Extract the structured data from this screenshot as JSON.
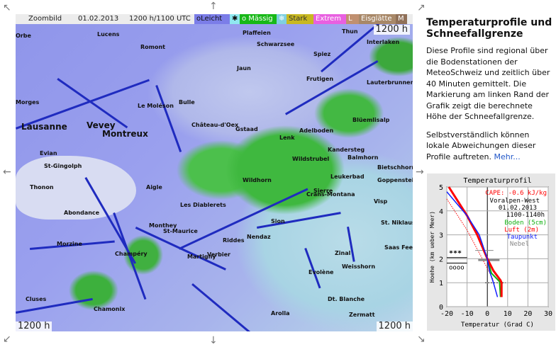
{
  "map": {
    "header": {
      "title": "Zoombild",
      "date": "01.02.2013",
      "time": "1200 h/1100 UTC"
    },
    "legend": [
      {
        "label": "oLeicht",
        "bg": "#7b7de8",
        "fg": "#111"
      },
      {
        "label": "✱",
        "bg": "#90e8f0",
        "fg": "#111"
      },
      {
        "label": "o Mässig",
        "bg": "#18b818",
        "fg": "#fff"
      },
      {
        "label": "❄",
        "bg": "#80d0e0",
        "fg": "#fff"
      },
      {
        "label": "Stark",
        "bg": "#c8b820",
        "fg": "#333"
      },
      {
        "label": "Extrem",
        "bg": "#e860e0",
        "fg": "#fff"
      },
      {
        "label": "L",
        "bg": "#c09070",
        "fg": "#fff"
      },
      {
        "label": "Eisglätte",
        "bg": "#a88868",
        "fg": "#fff"
      },
      {
        "label": "M",
        "bg": "#907058",
        "fg": "#fff"
      }
    ],
    "height_labels": {
      "top_right": "1200 h",
      "bottom_left": "1200 h",
      "bottom_right": "1200 h"
    },
    "places": [
      "Lausanne",
      "Vevey",
      "Montreux",
      "Evian",
      "Thonon",
      "Morges",
      "Orbe",
      "Lucens",
      "Romont",
      "Bulle",
      "Le Moléson",
      "Château-d'Oex",
      "Gstaad",
      "Lenk",
      "Adelboden",
      "Kandersteg",
      "Interlaken",
      "Frutigen",
      "Spiez",
      "Thun",
      "Schwarzsee",
      "Plaffeien",
      "Jaun",
      "Wildstrubel",
      "Wildhorn",
      "Les Diablerets",
      "Leukerbad",
      "Sierre",
      "Sion",
      "Martigny",
      "Monthey",
      "Aigle",
      "St-Maurice",
      "Champéry",
      "Verbier",
      "Zinal",
      "Weisshorn",
      "Dt. Blanche",
      "Zermatt",
      "Saas Fee",
      "Visp",
      "Bietschhorn",
      "Balmhorn",
      "Blüemlisalp",
      "Lauterbrunnen",
      "Cluses",
      "Chamonix",
      "St-Gingolph",
      "Abondance",
      "Morzine",
      "Evolène",
      "Nendaz",
      "Riddes",
      "Crans-Montana",
      "Arolla",
      "St. Niklaus",
      "Goppenstein"
    ]
  },
  "sidebar": {
    "title": "Temperaturprofile und Schneefallgrenze",
    "paragraph1": "Diese Profile sind regional über die Bodenstationen der MeteoSchweiz und zeitlich über 40 Minuten gemittelt. Die Markierung am linken Rand der Grafik zeigt die berechnete Höhe der Schneefallgrenze.",
    "paragraph2": "Selbstverständlich können lokale Abweichungen dieser Profile auftreten.",
    "more_link": "Mehr..."
  },
  "chart_data": {
    "type": "line",
    "title": "Temperaturprofil",
    "xlabel": "Temperatur (Grad C)",
    "ylabel": "Hoehe (km ueber Meer)",
    "xlim": [
      -20,
      30
    ],
    "ylim": [
      0,
      5
    ],
    "xticks": [
      "-20",
      "-10",
      "0",
      "10",
      "20",
      "30"
    ],
    "yticks": [
      "0",
      "1",
      "2",
      "3",
      "4",
      "5"
    ],
    "grid": true,
    "annotations": {
      "cape": "CAPE: -0.6 kJ/kg",
      "region": "Voralpen-West",
      "date": "01.02.2013",
      "time": "1100-1140h"
    },
    "series": [
      {
        "name": "Boden (5cm)",
        "color": "#10b010",
        "points": [
          [
            -19,
            5
          ],
          [
            -10,
            3.8
          ],
          [
            -5,
            3
          ],
          [
            0,
            2
          ],
          [
            2,
            1.4
          ],
          [
            6,
            1.05
          ],
          [
            6.5,
            0.4
          ]
        ]
      },
      {
        "name": "Luft (2m)",
        "color": "#ff0000",
        "points": [
          [
            -19,
            5
          ],
          [
            -10,
            3.8
          ],
          [
            -5,
            3
          ],
          [
            0,
            2
          ],
          [
            3,
            1.5
          ],
          [
            6.5,
            1.1
          ],
          [
            7,
            1
          ],
          [
            7,
            0.4
          ]
        ]
      },
      {
        "name": "Taupunkt",
        "color": "#1020ff",
        "points": [
          [
            -20,
            4.8
          ],
          [
            -10,
            3.8
          ],
          [
            -4,
            3
          ],
          [
            0,
            2
          ],
          [
            1,
            1.5
          ],
          [
            3,
            1
          ],
          [
            5,
            0.4
          ]
        ]
      },
      {
        "name": "Nebel",
        "color": "#888888",
        "points": []
      }
    ],
    "extra_lines": {
      "dotted_red": [
        [
          -20,
          4.5
        ],
        [
          -10,
          3.2
        ],
        [
          0,
          1.6
        ],
        [
          3,
          1.1
        ]
      ],
      "nebel_upper": [
        [
          -6,
          2.35
        ],
        [
          3,
          2.35
        ]
      ],
      "nebel_lower": [
        [
          -4.5,
          1.95
        ],
        [
          6,
          1.95
        ]
      ],
      "dotted_black": [
        [
          -1,
          1
        ],
        [
          9,
          1
        ]
      ]
    },
    "snowfall_limit": {
      "snow_symbol": "***",
      "rain_symbol": "oooo",
      "upper_km": 2.05,
      "lower_km": 1.82
    }
  }
}
